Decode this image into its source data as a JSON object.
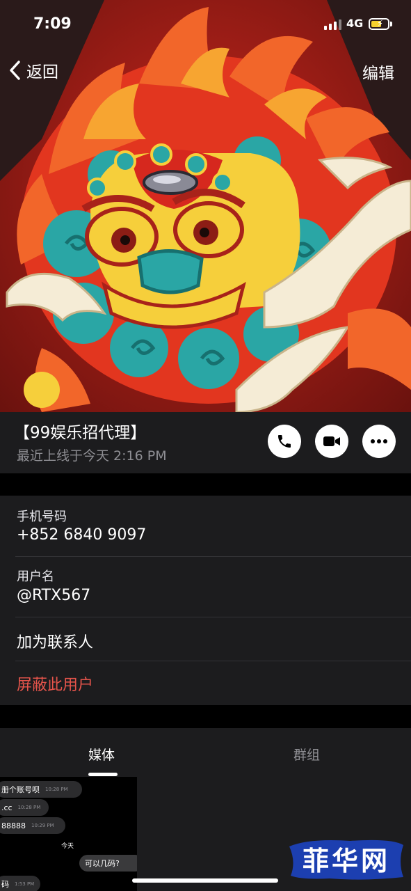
{
  "status_bar": {
    "time": "7:09",
    "network": "4G"
  },
  "nav": {
    "back_label": "返回",
    "edit_label": "编辑"
  },
  "profile": {
    "name": "【99娱乐招代理】",
    "last_seen": "最近上线于今天 2:16 PM",
    "actions": [
      {
        "icon": "phone-icon"
      },
      {
        "icon": "video-camera-icon"
      },
      {
        "icon": "more-icon"
      }
    ]
  },
  "info": {
    "phone_label": "手机号码",
    "phone_value": "+852 6840 9097",
    "username_label": "用户名",
    "username_value": "@RTX567",
    "add_contact": "加为联系人",
    "block_user": "屏蔽此用户"
  },
  "tabs": [
    {
      "label": "媒体",
      "active": true
    },
    {
      "label": "群组",
      "active": false
    }
  ],
  "media_thumbnail": {
    "messages": [
      {
        "text": "册个账号呗",
        "time": "10:28 PM"
      },
      {
        "text": ".cc",
        "time": "10:28 PM"
      },
      {
        "text": "88888",
        "time": "10:29 PM"
      },
      {
        "text": "可以几码?",
        "time": ""
      },
      {
        "text": "码",
        "time": "1:53 PM"
      }
    ],
    "day_label": "今天"
  },
  "watermark": {
    "text": "菲华网"
  },
  "colors": {
    "background": "#000000",
    "panel": "#1c1c1e",
    "secondary_text": "#8e8e93",
    "destructive": "#e5544b",
    "hero_red": "#b22418"
  }
}
